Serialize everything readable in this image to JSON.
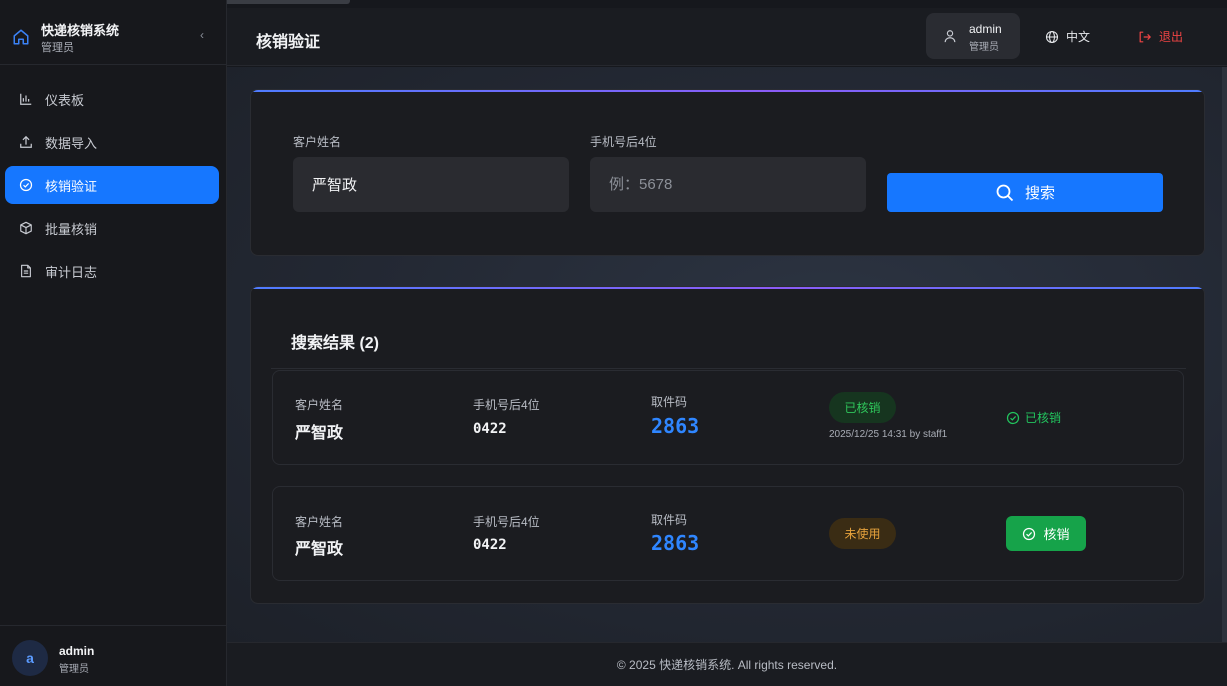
{
  "app": {
    "title": "快递核销系统",
    "role": "管理员"
  },
  "sidebar": {
    "items": [
      {
        "label": "仪表板",
        "icon": "chart-bar-icon",
        "active": false
      },
      {
        "label": "数据导入",
        "icon": "upload-icon",
        "active": false
      },
      {
        "label": "核销验证",
        "icon": "check-circle-icon",
        "active": true
      },
      {
        "label": "批量核销",
        "icon": "box-icon",
        "active": false
      },
      {
        "label": "审计日志",
        "icon": "document-icon",
        "active": false
      }
    ],
    "collapse_glyph": "‹",
    "user": {
      "avatar": "a",
      "name": "admin",
      "role": "管理员"
    }
  },
  "header": {
    "title": "核销验证",
    "user": {
      "name": "admin",
      "role": "管理员"
    },
    "language": "中文",
    "logout": "退出"
  },
  "search": {
    "name_label": "客户姓名",
    "name_value": "严智政",
    "phone_label": "手机号后4位",
    "phone_value": "",
    "phone_placeholder": "例：5678",
    "button": "搜索"
  },
  "results": {
    "title": "搜索结果 (2)",
    "labels": {
      "name": "客户姓名",
      "phone": "手机号后4位",
      "code": "取件码"
    },
    "rows": [
      {
        "name": "严智政",
        "phone": "0422",
        "code": "2863",
        "status": "已核销",
        "status_type": "used",
        "verified_at": "2025/12/25 14:31 by staff1",
        "action": "已核销"
      },
      {
        "name": "严智政",
        "phone": "0422",
        "code": "2863",
        "status": "未使用",
        "status_type": "unused",
        "verified_at": "",
        "action": "核销"
      }
    ]
  },
  "footer": {
    "text": "© 2025 快递核销系统. All rights reserved."
  },
  "colors": {
    "accent": "#1677ff",
    "success": "#16a34a",
    "warning": "#e6a23c",
    "danger": "#ef4444",
    "code": "#2f86ff"
  }
}
